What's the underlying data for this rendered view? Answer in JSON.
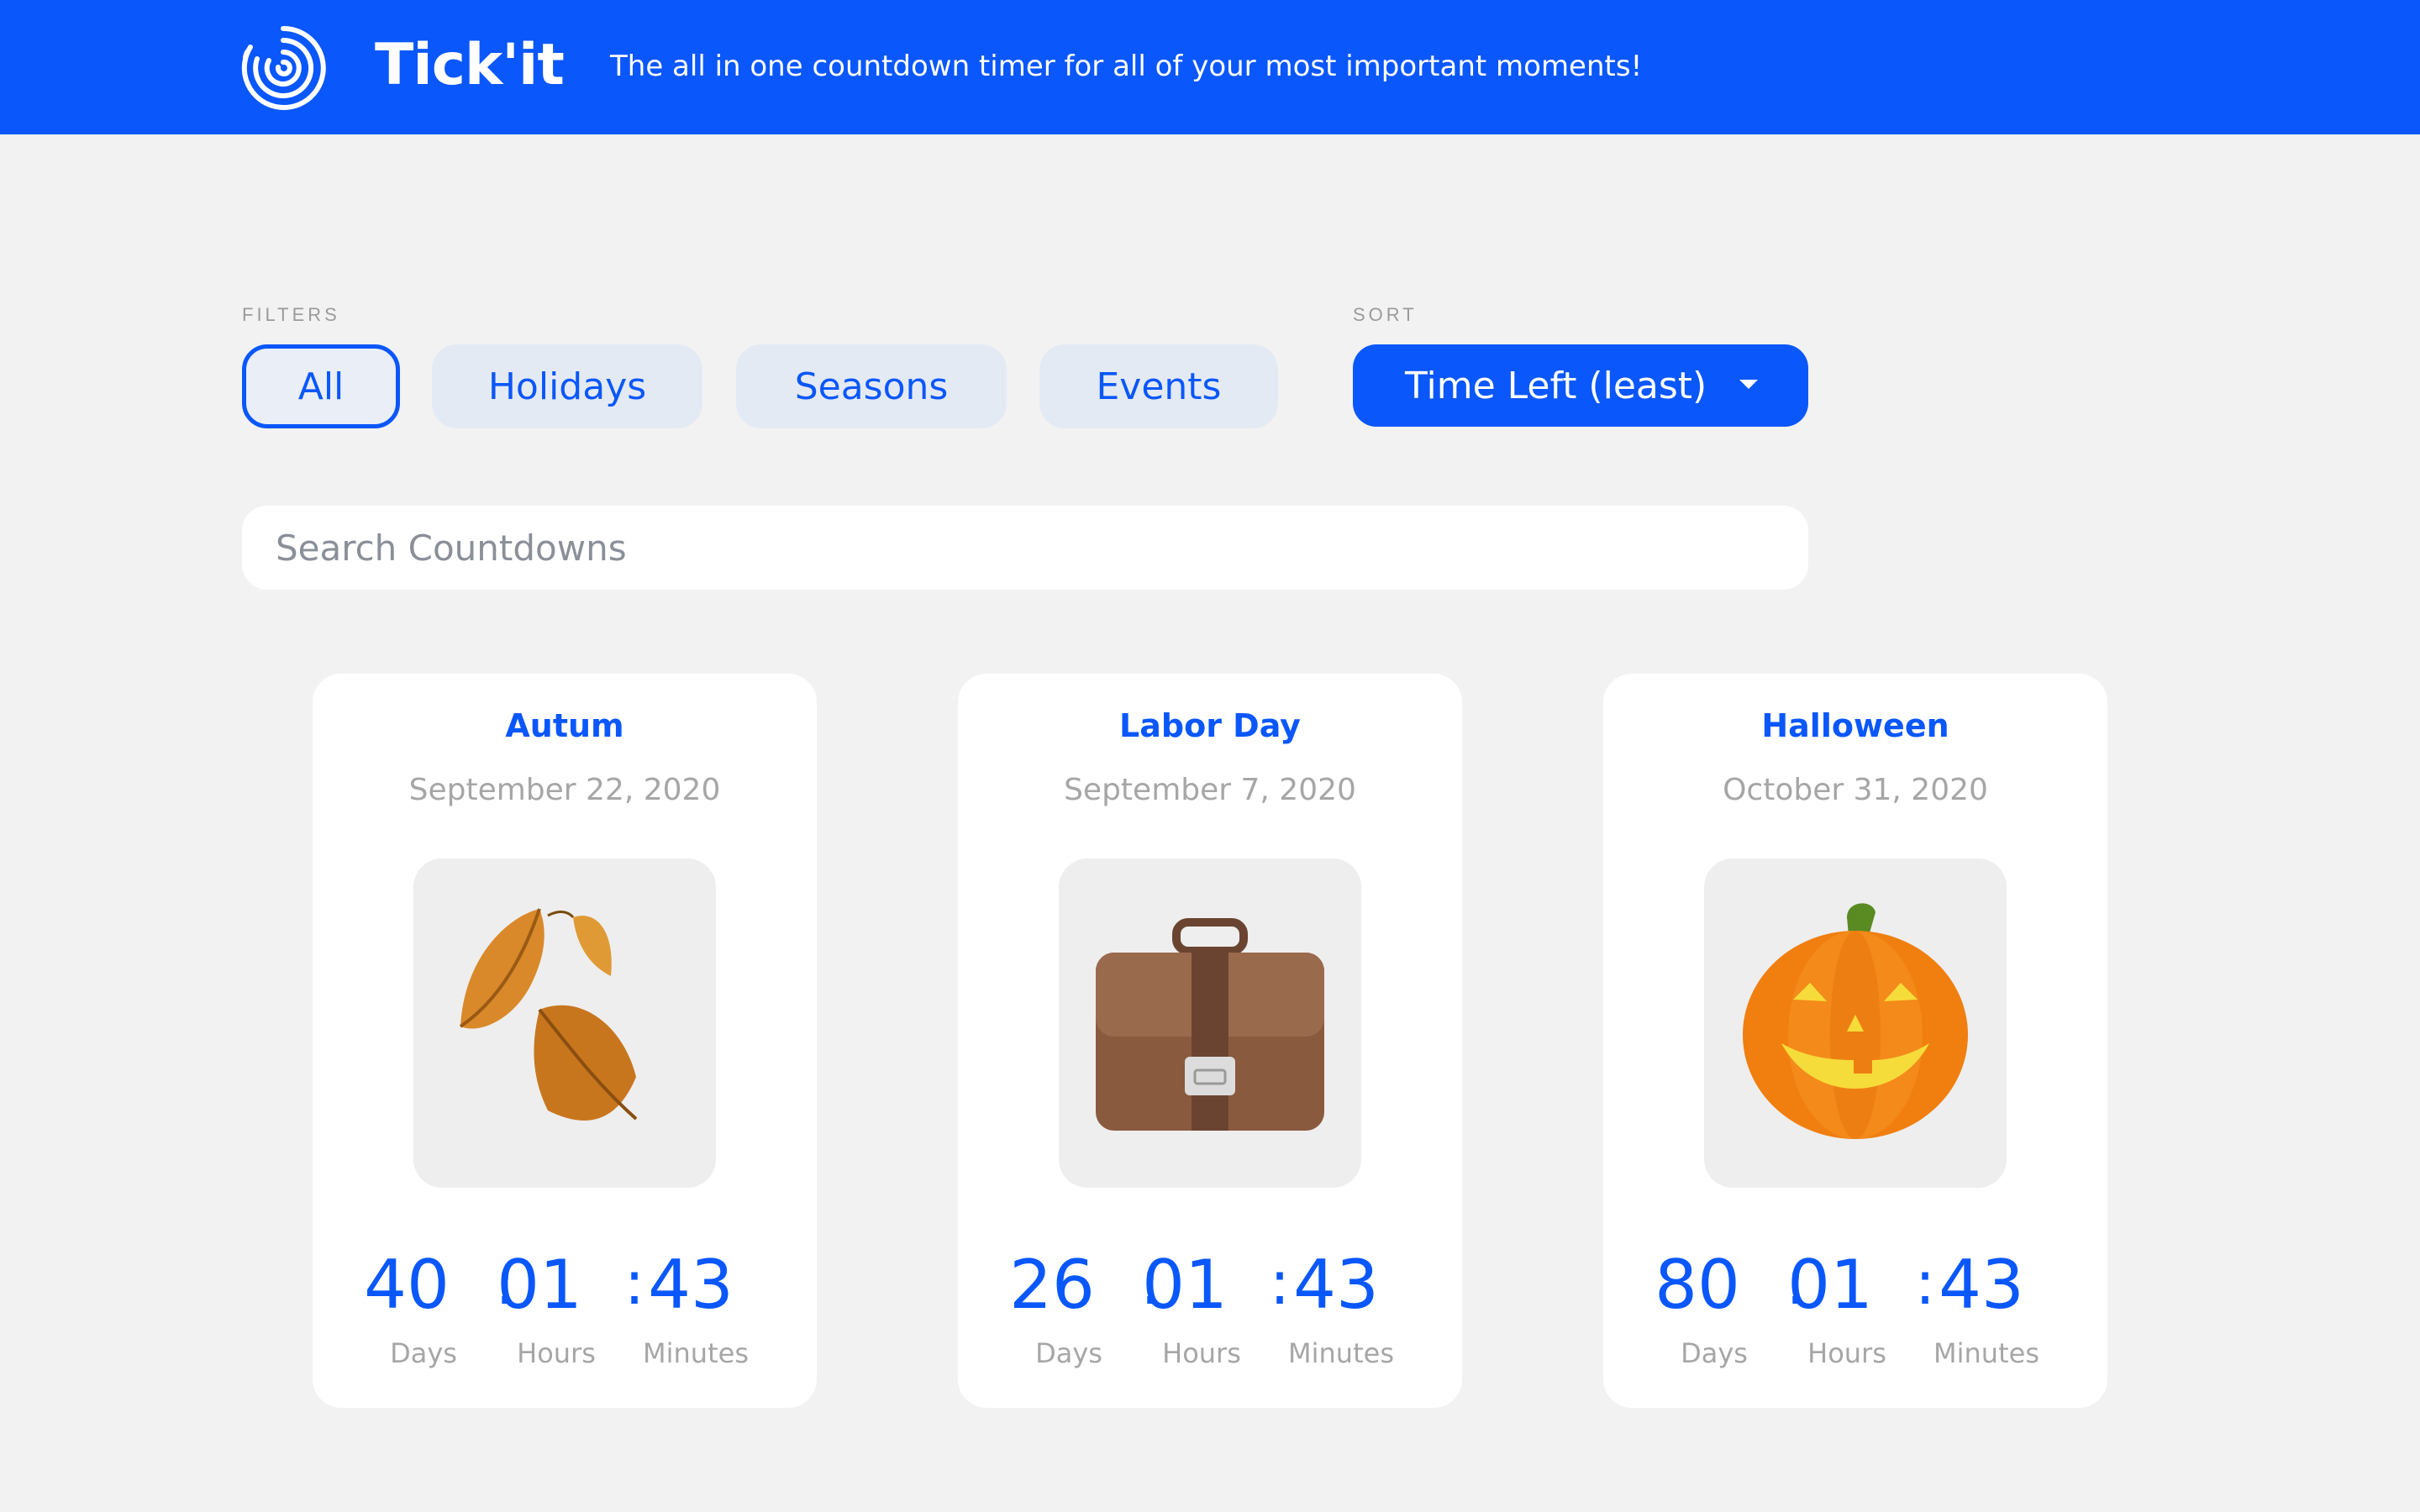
{
  "header": {
    "brand": "Tick'it",
    "tagline": "The all in one countdown timer for all of your most important moments!",
    "background": "#0a57fb",
    "logo_icon": "countdown-spiral-icon"
  },
  "filters": {
    "label": "FILTERS",
    "items": [
      {
        "label": "All",
        "active": true
      },
      {
        "label": "Holidays",
        "active": false
      },
      {
        "label": "Seasons",
        "active": false
      },
      {
        "label": "Events",
        "active": false
      }
    ]
  },
  "sort": {
    "label": "SORT",
    "selected": "Time Left (least)",
    "icon": "caret-down-icon"
  },
  "search": {
    "placeholder": "Search Countdowns",
    "value": ""
  },
  "cards": [
    {
      "title": "Autum",
      "date": "September 22, 2020",
      "icon": "fallen-leaves-icon",
      "days": "40",
      "hours": "01",
      "minutes": "43",
      "days_label": "Days",
      "hours_label": "Hours",
      "minutes_label": "Minutes",
      "separator": ":"
    },
    {
      "title": "Labor Day",
      "date": "September 7, 2020",
      "icon": "briefcase-icon",
      "days": "26",
      "hours": "01",
      "minutes": "43",
      "days_label": "Days",
      "hours_label": "Hours",
      "minutes_label": "Minutes",
      "separator": ":"
    },
    {
      "title": "Halloween",
      "date": "October 31, 2020",
      "icon": "jack-o-lantern-icon",
      "days": "80",
      "hours": "01",
      "minutes": "43",
      "days_label": "Days",
      "hours_label": "Hours",
      "minutes_label": "Minutes",
      "separator": ":"
    }
  ],
  "colors": {
    "accent": "#0a57fb",
    "page_background": "#f2f2f2",
    "muted_text": "#a6a6a6",
    "pill_background": "#e4eaf3"
  }
}
